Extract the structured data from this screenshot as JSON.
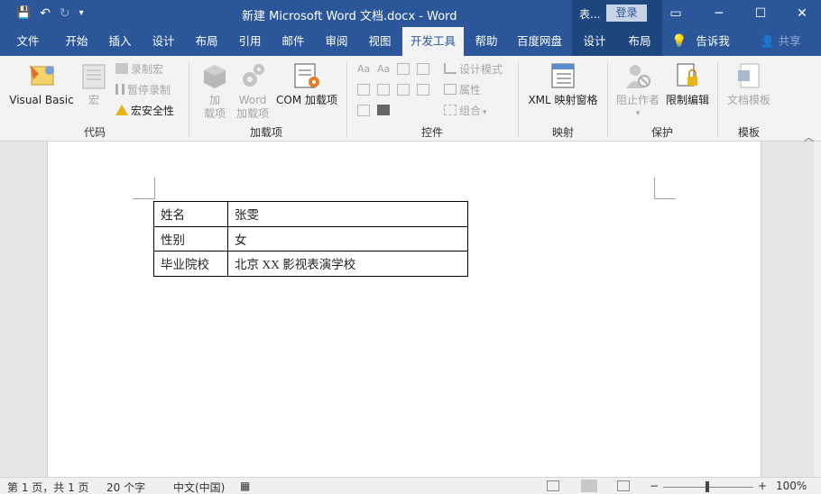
{
  "titlebar": {
    "doc_title": "新建 Microsoft Word 文档.docx  -  Word",
    "context_label": "表...",
    "login": "登录",
    "minimize": "─",
    "restore_ribbon": "▭",
    "maximize": "☐",
    "close": "✕"
  },
  "qat": {
    "save": "💾",
    "undo": "↶",
    "redo": "↻",
    "customize": "▾"
  },
  "tabs": [
    "文件",
    "开始",
    "插入",
    "设计",
    "布局",
    "引用",
    "邮件",
    "审阅",
    "视图",
    "开发工具",
    "帮助",
    "百度网盘",
    "设计",
    "布局"
  ],
  "active_tab": "开发工具",
  "tell_me": "告诉我",
  "share": "共享",
  "ribbon": {
    "code": {
      "label": "代码",
      "visual_basic": "Visual Basic",
      "macro": "宏",
      "record_macro": "录制宏",
      "pause_recording": "暂停录制",
      "macro_security": "宏安全性"
    },
    "addins": {
      "label": "加载项",
      "addins": "加\n载项",
      "word_addins": "Word\n加载项",
      "com_addins": "COM 加载项"
    },
    "controls": {
      "label": "控件",
      "design_mode": "设计模式",
      "properties": "属性",
      "group": "组合"
    },
    "mapping": {
      "label": "映射",
      "xml_pane": "XML 映射窗格"
    },
    "protect": {
      "label": "保护",
      "block_authors": "阻止作者",
      "restrict_editing": "限制编辑"
    },
    "templates": {
      "label": "模板",
      "document_template": "文档模板"
    }
  },
  "document": {
    "table": [
      {
        "key": "姓名",
        "value": "张雯"
      },
      {
        "key": "性别",
        "value": "女"
      },
      {
        "key": "毕业院校",
        "value": "北京 XX 影视表演学校"
      }
    ]
  },
  "statusbar": {
    "page": "第 1 页，共 1 页",
    "words": "20 个字",
    "language": "中文(中国)",
    "zoom": "100%",
    "zoom_minus": "−",
    "zoom_plus": "+"
  },
  "colors": {
    "accent": "#2b579a",
    "context_tab": "#1e467f",
    "ribbon_bg": "#f3f3f3"
  }
}
